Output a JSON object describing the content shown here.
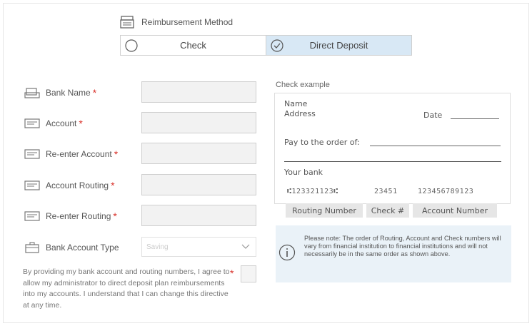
{
  "reimbursement": {
    "title": "Reimbursement Method",
    "options": [
      {
        "label": "Check",
        "selected": false
      },
      {
        "label": "Direct Deposit",
        "selected": true
      }
    ]
  },
  "form": {
    "fields": [
      {
        "label": "Bank Name",
        "required": "*",
        "icon": "bank-icon"
      },
      {
        "label": "Account",
        "required": "*",
        "icon": "card-icon"
      },
      {
        "label": "Re-enter Account",
        "required": "*",
        "icon": "card-icon"
      },
      {
        "label": "Account Routing",
        "required": "*",
        "icon": "card-icon"
      },
      {
        "label": "Re-enter Routing",
        "required": "*",
        "icon": "card-icon"
      }
    ],
    "account_type": {
      "label": "Bank Account Type",
      "placeholder": "Saving",
      "icon": "briefcase-icon"
    },
    "consent": {
      "text": "By providing my bank account and routing numbers, I agree to allow my administrator to direct deposit plan reimbursements into my accounts. I understand that I can change this directive at any time.",
      "required": "*"
    }
  },
  "check_example": {
    "title": "Check example",
    "name": "Name",
    "address": "Address",
    "date": "Date",
    "pay_to": "Pay to the order of:",
    "bank": "Your bank",
    "micr_routing": "⑆123321123⑆",
    "micr_check": "23451",
    "micr_account": "123456789123",
    "cap_routing": "Routing Number",
    "cap_check": "Check #",
    "cap_account": "Account Number"
  },
  "note": {
    "text": "Please note: The order of Routing, Account and Check numbers will vary from financial institution to financial institutions and will not necessarily be in the same order as shown above."
  },
  "colors": {
    "accent_bg": "#d8e8f5",
    "required": "#d9322b",
    "note_bg": "#eaf2f8"
  }
}
